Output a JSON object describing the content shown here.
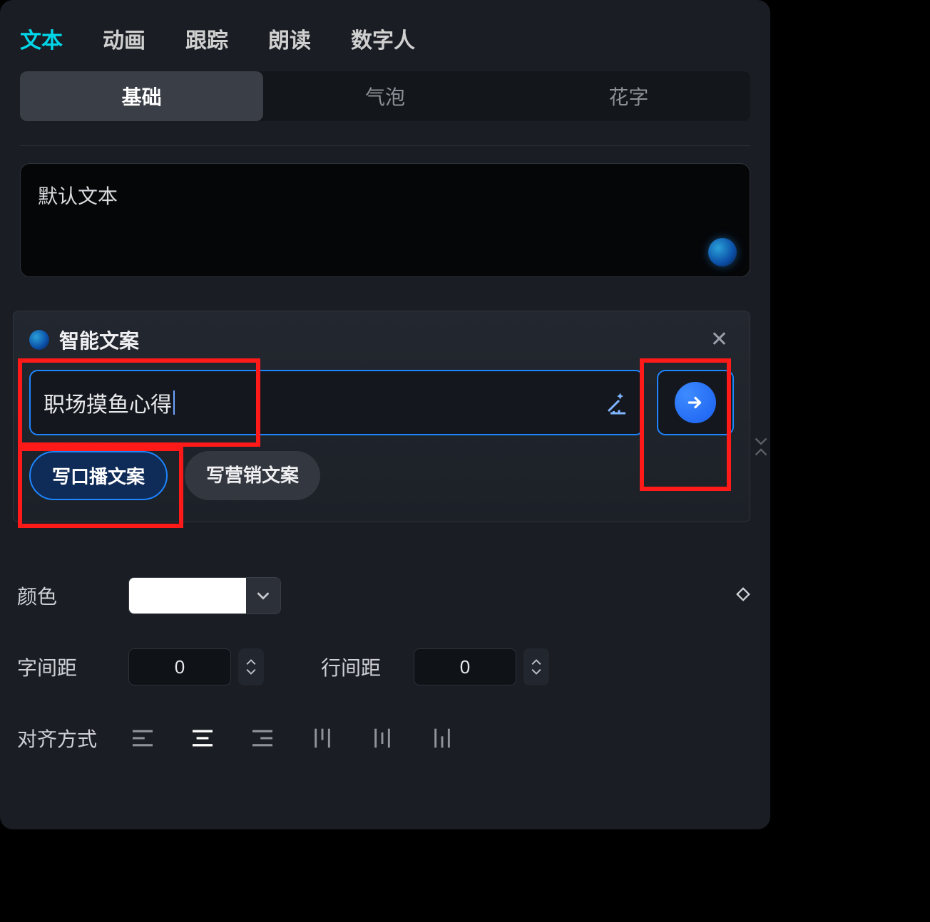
{
  "tabs": {
    "items": [
      "文本",
      "动画",
      "跟踪",
      "朗读",
      "数字人"
    ],
    "activeIndex": 0
  },
  "subTabs": {
    "items": [
      "基础",
      "气泡",
      "花字"
    ],
    "activeIndex": 0
  },
  "textBox": {
    "value": "默认文本"
  },
  "smartCopy": {
    "title": "智能文案",
    "promptValue": "职场摸鱼心得",
    "chips": [
      "写口播文案",
      "写营销文案"
    ],
    "activeChip": 0
  },
  "controls": {
    "colorLabel": "颜色",
    "colorValue": "#FFFFFF",
    "letterSpacingLabel": "字间距",
    "letterSpacingValue": "0",
    "lineSpacingLabel": "行间距",
    "lineSpacingValue": "0",
    "alignLabel": "对齐方式"
  },
  "icons": {
    "wand": "magic-wand-icon",
    "send": "arrow-right-icon",
    "close": "close-icon",
    "dropdown": "chevron-down-icon",
    "diamond": "keyframe-diamond-icon"
  }
}
